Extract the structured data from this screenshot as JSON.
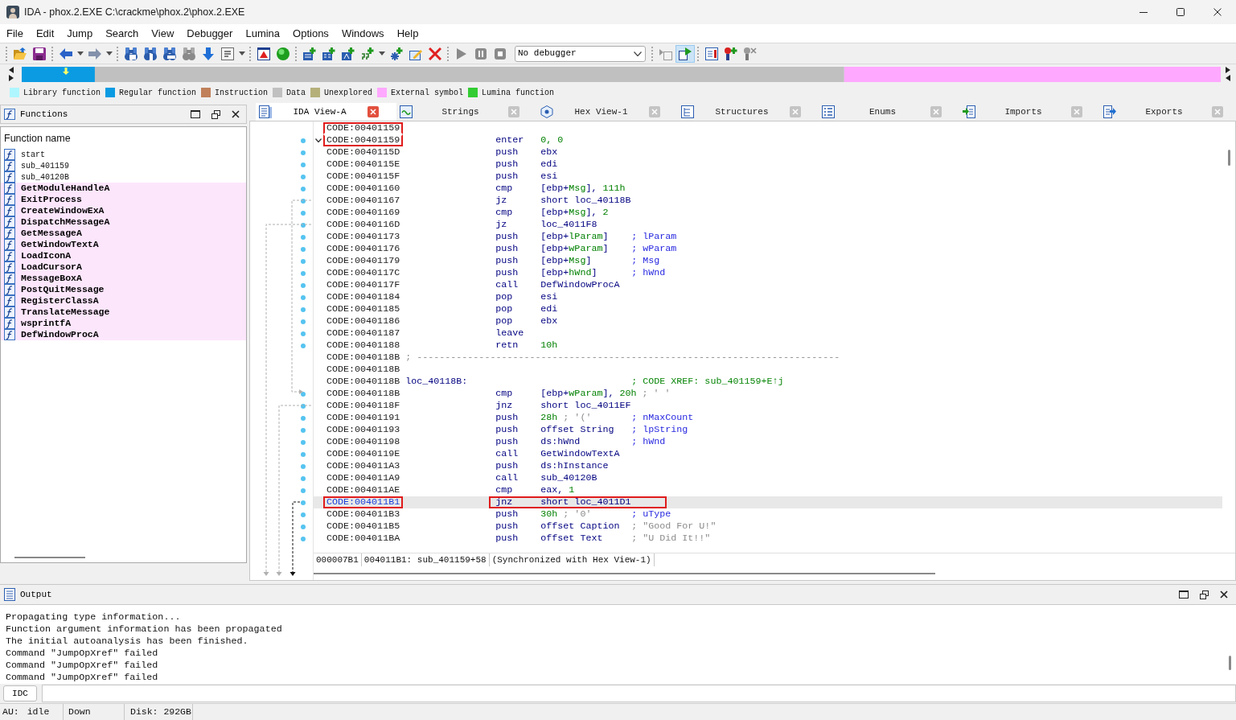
{
  "window": {
    "title": "IDA - phox.2.EXE C:\\crackme\\phox.2\\phox.2.EXE"
  },
  "menu": [
    "File",
    "Edit",
    "Jump",
    "Search",
    "View",
    "Debugger",
    "Lumina",
    "Options",
    "Windows",
    "Help"
  ],
  "toolbar": {
    "groups": [
      [
        {
          "kind": "open",
          "pressed": false
        },
        {
          "kind": "save",
          "pressed": false
        }
      ],
      [
        {
          "kind": "back",
          "pressed": false
        },
        {
          "kind": "caret",
          "pressed": false
        },
        {
          "kind": "forward",
          "pressed": false
        },
        {
          "kind": "caret",
          "pressed": false
        }
      ],
      [
        {
          "kind": "find_hex",
          "pressed": false
        },
        {
          "kind": "find_text",
          "pressed": false
        },
        {
          "kind": "find_bin",
          "pressed": false
        },
        {
          "kind": "find_next",
          "pressed": false
        },
        {
          "kind": "jump",
          "pressed": false
        },
        {
          "kind": "font",
          "pressed": false
        },
        {
          "kind": "caret",
          "pressed": false
        }
      ],
      [
        {
          "kind": "warning",
          "pressed": false
        },
        {
          "kind": "ball",
          "pressed": false
        }
      ],
      [
        {
          "kind": "add_code",
          "pressed": false
        },
        {
          "kind": "add_data",
          "pressed": false
        },
        {
          "kind": "add_text",
          "pressed": false
        },
        {
          "kind": "add_string",
          "pressed": false
        },
        {
          "kind": "caret",
          "pressed": false
        },
        {
          "kind": "add_struct",
          "pressed": false
        },
        {
          "kind": "edit",
          "pressed": false
        },
        {
          "kind": "delete",
          "pressed": false
        }
      ],
      [
        {
          "kind": "play",
          "pressed": false
        },
        {
          "kind": "pause",
          "pressed": false
        },
        {
          "kind": "stop",
          "pressed": false
        },
        {
          "kind": "select",
          "value": "No debugger"
        }
      ],
      [
        {
          "kind": "step",
          "pressed": false
        },
        {
          "kind": "run",
          "pressed": true
        }
      ],
      [
        {
          "kind": "bp_list",
          "pressed": false
        },
        {
          "kind": "bp_add",
          "pressed": false
        },
        {
          "kind": "bp_del",
          "pressed": false
        }
      ]
    ]
  },
  "legend": [
    {
      "label": "Library function",
      "color": "#aef6ff"
    },
    {
      "label": "Regular function",
      "color": "#0a9be3"
    },
    {
      "label": "Instruction",
      "color": "#c0805a"
    },
    {
      "label": "Data",
      "color": "#c0c0c0"
    },
    {
      "label": "Unexplored",
      "color": "#b5b07a"
    },
    {
      "label": "External symbol",
      "color": "#ffa8ff"
    },
    {
      "label": "Lumina function",
      "color": "#33cc33"
    }
  ],
  "functions": {
    "title": "Functions",
    "column": "Function name",
    "items": [
      {
        "name": "start",
        "kind": "function"
      },
      {
        "name": "sub_401159",
        "kind": "function"
      },
      {
        "name": "sub_40120B",
        "kind": "function"
      },
      {
        "name": "GetModuleHandleA",
        "kind": "import"
      },
      {
        "name": "ExitProcess",
        "kind": "import"
      },
      {
        "name": "CreateWindowExA",
        "kind": "import"
      },
      {
        "name": "DispatchMessageA",
        "kind": "import"
      },
      {
        "name": "GetMessageA",
        "kind": "import"
      },
      {
        "name": "GetWindowTextA",
        "kind": "import"
      },
      {
        "name": "LoadIconA",
        "kind": "import"
      },
      {
        "name": "LoadCursorA",
        "kind": "import"
      },
      {
        "name": "MessageBoxA",
        "kind": "import"
      },
      {
        "name": "PostQuitMessage",
        "kind": "import"
      },
      {
        "name": "RegisterClassA",
        "kind": "import"
      },
      {
        "name": "TranslateMessage",
        "kind": "import"
      },
      {
        "name": "wsprintfA",
        "kind": "import"
      },
      {
        "name": "DefWindowProcA",
        "kind": "import"
      }
    ]
  },
  "tabs": [
    {
      "label": "IDA View-A",
      "kind": "disassembly",
      "selected": true
    },
    {
      "label": "Strings",
      "kind": "strings",
      "selected": false
    },
    {
      "label": "Hex View-1",
      "kind": "hex",
      "selected": false
    },
    {
      "label": "Structures",
      "kind": "structures",
      "selected": false
    },
    {
      "label": "Enums",
      "kind": "enums",
      "selected": false
    },
    {
      "label": "Imports",
      "kind": "imports",
      "selected": false
    },
    {
      "label": "Exports",
      "kind": "exports",
      "selected": false
    }
  ],
  "code": {
    "lines": [
      {
        "address": "CODE:00401159",
        "selected": false,
        "box_address": true
      },
      {
        "address": "CODE:00401159",
        "selected": false,
        "box_address": true,
        "expanded": true,
        "mnemonic": "enter",
        "operands": [
          {
            "text": "0, 0",
            "kind": "value"
          }
        ]
      },
      {
        "address": "CODE:0040115D",
        "selected": false,
        "box_address": false,
        "mnemonic": "push",
        "operands": [
          {
            "text": "ebx",
            "kind": "plain"
          }
        ]
      },
      {
        "address": "CODE:0040115E",
        "selected": false,
        "box_address": false,
        "mnemonic": "push",
        "operands": [
          {
            "text": "edi",
            "kind": "plain"
          }
        ]
      },
      {
        "address": "CODE:0040115F",
        "selected": false,
        "box_address": false,
        "mnemonic": "push",
        "operands": [
          {
            "text": "esi",
            "kind": "plain"
          }
        ]
      },
      {
        "address": "CODE:00401160",
        "selected": false,
        "box_address": false,
        "mnemonic": "cmp",
        "operands": [
          {
            "text": "[ebp+",
            "kind": "plain"
          },
          {
            "text": "Msg",
            "kind": "value"
          },
          {
            "text": "], ",
            "kind": "plain"
          },
          {
            "text": "111h",
            "kind": "value"
          }
        ]
      },
      {
        "address": "CODE:00401167",
        "selected": false,
        "box_address": false,
        "mnemonic": "jz",
        "operands": [
          {
            "text": "short loc_40118B",
            "kind": "plain"
          }
        ]
      },
      {
        "address": "CODE:00401169",
        "selected": false,
        "box_address": false,
        "mnemonic": "cmp",
        "operands": [
          {
            "text": "[ebp+",
            "kind": "plain"
          },
          {
            "text": "Msg",
            "kind": "value"
          },
          {
            "text": "], ",
            "kind": "plain"
          },
          {
            "text": "2",
            "kind": "value"
          }
        ]
      },
      {
        "address": "CODE:0040116D",
        "selected": false,
        "box_address": false,
        "mnemonic": "jz",
        "operands": [
          {
            "text": "loc_4011F8",
            "kind": "plain"
          }
        ]
      },
      {
        "address": "CODE:00401173",
        "selected": false,
        "box_address": false,
        "mnemonic": "push",
        "operands": [
          {
            "text": "[ebp+",
            "kind": "plain"
          },
          {
            "text": "lParam",
            "kind": "value"
          },
          {
            "text": "]",
            "kind": "plain"
          }
        ],
        "comment": {
          "text": "; lParam",
          "kind": "auto"
        }
      },
      {
        "address": "CODE:00401176",
        "selected": false,
        "box_address": false,
        "mnemonic": "push",
        "operands": [
          {
            "text": "[ebp+",
            "kind": "plain"
          },
          {
            "text": "wParam",
            "kind": "value"
          },
          {
            "text": "]",
            "kind": "plain"
          }
        ],
        "comment": {
          "text": "; wParam",
          "kind": "auto"
        }
      },
      {
        "address": "CODE:00401179",
        "selected": false,
        "box_address": false,
        "mnemonic": "push",
        "operands": [
          {
            "text": "[ebp+",
            "kind": "plain"
          },
          {
            "text": "Msg",
            "kind": "value"
          },
          {
            "text": "]",
            "kind": "plain"
          }
        ],
        "comment": {
          "text": "; Msg",
          "kind": "auto"
        }
      },
      {
        "address": "CODE:0040117C",
        "selected": false,
        "box_address": false,
        "mnemonic": "push",
        "operands": [
          {
            "text": "[ebp+",
            "kind": "plain"
          },
          {
            "text": "hWnd",
            "kind": "value"
          },
          {
            "text": "]",
            "kind": "plain"
          }
        ],
        "comment": {
          "text": "; hWnd",
          "kind": "auto"
        }
      },
      {
        "address": "CODE:0040117F",
        "selected": false,
        "box_address": false,
        "mnemonic": "call",
        "operands": [
          {
            "text": "DefWindowProcA",
            "kind": "plain"
          }
        ]
      },
      {
        "address": "CODE:00401184",
        "selected": false,
        "box_address": false,
        "mnemonic": "pop",
        "operands": [
          {
            "text": "esi",
            "kind": "plain"
          }
        ]
      },
      {
        "address": "CODE:00401185",
        "selected": false,
        "box_address": false,
        "mnemonic": "pop",
        "operands": [
          {
            "text": "edi",
            "kind": "plain"
          }
        ]
      },
      {
        "address": "CODE:00401186",
        "selected": false,
        "box_address": false,
        "mnemonic": "pop",
        "operands": [
          {
            "text": "ebx",
            "kind": "plain"
          }
        ]
      },
      {
        "address": "CODE:00401187",
        "selected": false,
        "box_address": false,
        "mnemonic": "leave"
      },
      {
        "address": "CODE:00401188",
        "selected": false,
        "box_address": false,
        "mnemonic": "retn",
        "operands": [
          {
            "text": "10h",
            "kind": "value"
          }
        ]
      },
      {
        "address": "CODE:0040118B",
        "selected": false,
        "box_address": false,
        "separator": "; ---------------------------------------------------------------------------"
      },
      {
        "address": "CODE:0040118B",
        "selected": false,
        "box_address": false
      },
      {
        "address": "CODE:0040118B",
        "selected": false,
        "box_address": false,
        "label": "loc_40118B:",
        "comment": {
          "text": "; CODE XREF: sub_401159+E↑j",
          "kind": "xref"
        }
      },
      {
        "address": "CODE:0040118B",
        "selected": false,
        "box_address": false,
        "mnemonic": "cmp",
        "operands": [
          {
            "text": "[ebp+",
            "kind": "plain"
          },
          {
            "text": "wParam",
            "kind": "value"
          },
          {
            "text": "], ",
            "kind": "plain"
          },
          {
            "text": "20h",
            "kind": "value"
          },
          {
            "text": " ; ' '",
            "kind": "note"
          }
        ]
      },
      {
        "address": "CODE:0040118F",
        "selected": false,
        "box_address": false,
        "mnemonic": "jnz",
        "operands": [
          {
            "text": "short loc_4011EF",
            "kind": "plain"
          }
        ]
      },
      {
        "address": "CODE:00401191",
        "selected": false,
        "box_address": false,
        "mnemonic": "push",
        "operands": [
          {
            "text": "28h",
            "kind": "value"
          },
          {
            "text": " ; '('",
            "kind": "note"
          }
        ],
        "comment": {
          "text": "; nMaxCount",
          "kind": "auto"
        }
      },
      {
        "address": "CODE:00401193",
        "selected": false,
        "box_address": false,
        "mnemonic": "push",
        "operands": [
          {
            "text": "offset String",
            "kind": "plain"
          }
        ],
        "comment": {
          "text": "; lpString",
          "kind": "auto"
        }
      },
      {
        "address": "CODE:00401198",
        "selected": false,
        "box_address": false,
        "mnemonic": "push",
        "operands": [
          {
            "text": "ds:hWnd",
            "kind": "plain"
          }
        ],
        "comment": {
          "text": "; hWnd",
          "kind": "auto"
        }
      },
      {
        "address": "CODE:0040119E",
        "selected": false,
        "box_address": false,
        "mnemonic": "call",
        "operands": [
          {
            "text": "GetWindowTextA",
            "kind": "plain"
          }
        ]
      },
      {
        "address": "CODE:004011A3",
        "selected": false,
        "box_address": false,
        "mnemonic": "push",
        "operands": [
          {
            "text": "ds:hInstance",
            "kind": "plain"
          }
        ]
      },
      {
        "address": "CODE:004011A9",
        "selected": false,
        "box_address": false,
        "mnemonic": "call",
        "operands": [
          {
            "text": "sub_40120B",
            "kind": "plain"
          }
        ]
      },
      {
        "address": "CODE:004011AE",
        "selected": false,
        "box_address": false,
        "mnemonic": "cmp",
        "operands": [
          {
            "text": "eax, ",
            "kind": "plain"
          },
          {
            "text": "1",
            "kind": "value"
          }
        ]
      },
      {
        "address": "CODE:004011B1",
        "selected": true,
        "box_address": true,
        "box_instruction": true,
        "mnemonic": "jnz",
        "operands": [
          {
            "text": "short loc_4011D1",
            "kind": "plain"
          }
        ]
      },
      {
        "address": "CODE:004011B3",
        "selected": false,
        "box_address": false,
        "mnemonic": "push",
        "operands": [
          {
            "text": "30h",
            "kind": "value"
          },
          {
            "text": " ; '0'",
            "kind": "note"
          }
        ],
        "comment": {
          "text": "; uType",
          "kind": "auto"
        }
      },
      {
        "address": "CODE:004011B5",
        "selected": false,
        "box_address": false,
        "mnemonic": "push",
        "operands": [
          {
            "text": "offset Caption",
            "kind": "plain"
          }
        ],
        "comment": {
          "text": "; \"Good For U!\"",
          "kind": "string"
        }
      },
      {
        "address": "CODE:004011BA",
        "selected": false,
        "box_address": false,
        "mnemonic": "push",
        "operands": [
          {
            "text": "offset Text",
            "kind": "plain"
          }
        ],
        "comment": {
          "text": "; \"U Did It!!\"",
          "kind": "string"
        }
      }
    ],
    "status": [
      "000007B1",
      "004011B1: sub_401159+58",
      "(Synchronized with Hex View-1)"
    ]
  },
  "output": {
    "title": "Output",
    "lines": [
      "Propagating type information...",
      "Function argument information has been propagated",
      "The initial autoanalysis has been finished.",
      "Command \"JumpOpXref\" failed",
      "Command \"JumpOpXref\" failed",
      "Command \"JumpOpXref\" failed"
    ],
    "language": "IDC"
  },
  "status_bar": {
    "au_label": "AU:",
    "au_state": "idle",
    "direction": "Down",
    "disk": "Disk: 292GB"
  }
}
